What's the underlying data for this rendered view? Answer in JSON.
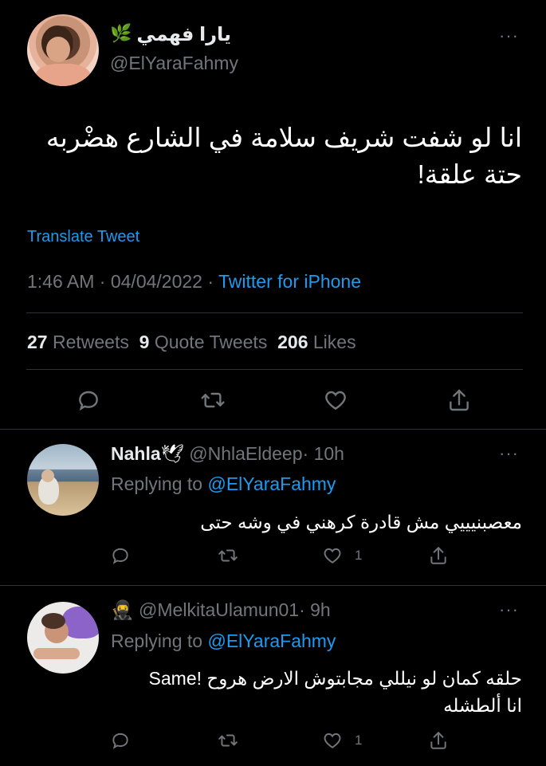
{
  "main_tweet": {
    "author_name": "يارا فهمي",
    "author_emoji": "🌿",
    "handle": "@ElYaraFahmy",
    "text_line1": "انا لو شفت شريف سلامة في الشارع هضْربه",
    "text_line2": "حتة علقة!",
    "translate_label": "Translate Tweet",
    "time": "1:46 AM",
    "sep1": "·",
    "date": "04/04/2022",
    "sep2": "·",
    "source": "Twitter for iPhone",
    "retweets_count": "27",
    "retweets_label": "Retweets",
    "quotes_count": "9",
    "quotes_label": "Quote Tweets",
    "likes_count": "206",
    "likes_label": "Likes",
    "more": "···"
  },
  "replies": [
    {
      "name": "Nahla",
      "name_emoji": "🕊",
      "handle": "@NhlaEldeep",
      "time": "· 10h",
      "replying_prefix": "Replying to",
      "replying_handle": "@ElYaraFahmy",
      "text_line1": "معصبنيييي مش قادرة كرهني في وشه حتى",
      "text_line2": "",
      "like_count": "1",
      "more": "···"
    },
    {
      "name": "",
      "name_emoji": "🥷",
      "handle": "@MelkitaUlamun01",
      "time": "· 9h",
      "replying_prefix": "Replying to",
      "replying_handle": "@ElYaraFahmy",
      "text_line1": "حلقه كمان لو نيللي مجابتوش الارض هروح !Same",
      "text_line2": "انا ألطشله",
      "like_count": "1",
      "more": "···"
    }
  ],
  "colors": {
    "background": "#000000",
    "text": "#e7e9ea",
    "muted": "#71767b",
    "link": "#1d9bf0",
    "divider": "#2f3336"
  }
}
